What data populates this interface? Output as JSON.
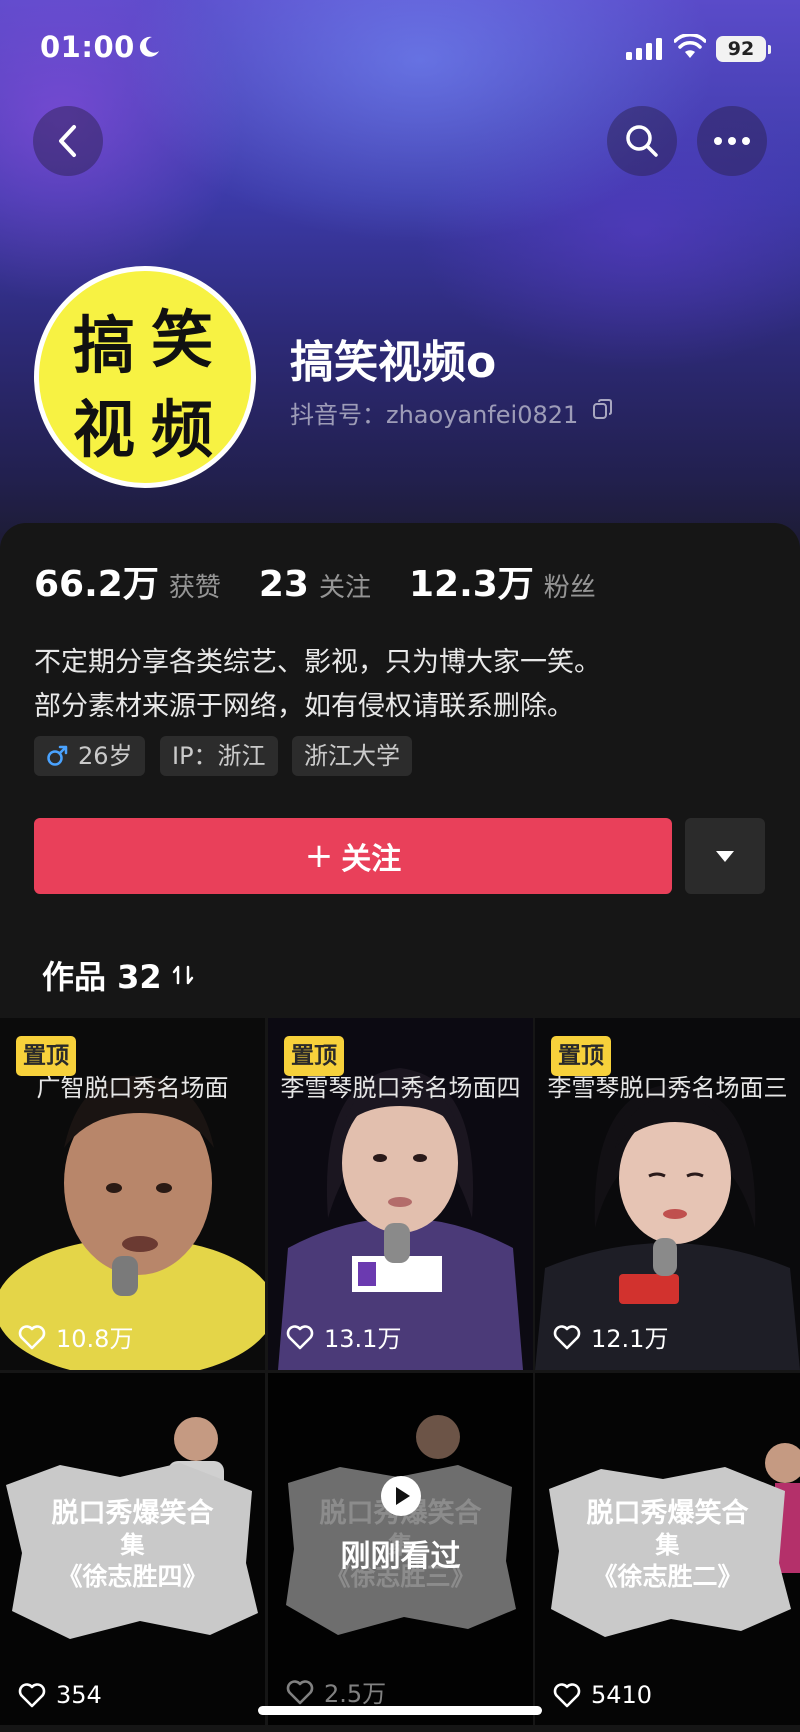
{
  "status_bar": {
    "time": "01:00",
    "battery": "92"
  },
  "profile": {
    "avatar_chars": [
      "搞",
      "笑",
      "视",
      "频"
    ],
    "name": "搞笑视频o",
    "douyin_id": "抖音号：zhaoyanfei0821"
  },
  "stats": [
    {
      "value": "66.2万",
      "label": "获赞"
    },
    {
      "value": "23",
      "label": "关注"
    },
    {
      "value": "12.3万",
      "label": "粉丝"
    }
  ],
  "bio": [
    "不定期分享各类综艺、影视，只为博大家一笑。",
    "部分素材来源于网络，如有侵权请联系删除。"
  ],
  "tags": {
    "age": "26岁",
    "ip": "IP：浙江",
    "school": "浙江大学"
  },
  "actions": {
    "follow_plus": "+",
    "follow_label": "关注"
  },
  "works": {
    "title": "作品 32"
  },
  "videos": [
    {
      "pinned": "置顶",
      "caption": "广智脱口秀名场面",
      "likes": "10.8万"
    },
    {
      "pinned": "置顶",
      "caption": "李雪琴脱口秀名场面四",
      "likes": "13.1万"
    },
    {
      "pinned": "置顶",
      "caption": "李雪琴脱口秀名场面三",
      "likes": "12.1万"
    },
    {
      "paper_lines": [
        "脱口秀爆笑合",
        "集",
        "《徐志胜四》"
      ],
      "likes": "354"
    },
    {
      "paper_lines": [
        "脱口秀爆笑合",
        "集",
        "《徐志胜三》"
      ],
      "likes": "2.5万",
      "watched": "刚刚看过"
    },
    {
      "paper_lines": [
        "脱口秀爆笑合",
        "集",
        "《徐志胜二》"
      ],
      "likes": "5410"
    }
  ],
  "colors": {
    "follow": "#e9405a",
    "pin": "#f7d13b",
    "avatar_bg": "#f7f243"
  }
}
